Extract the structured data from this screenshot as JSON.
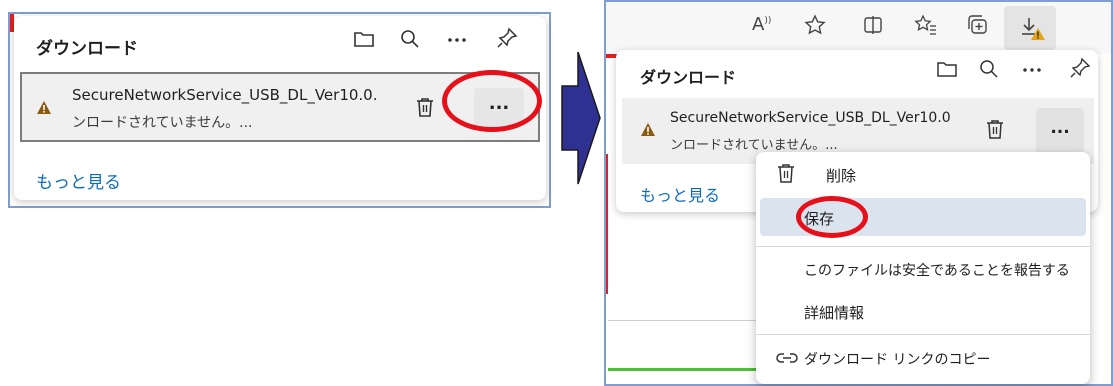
{
  "left": {
    "title": "ダウンロード",
    "file_name": "SecureNetworkService_USB_DL_Ver10.0.",
    "status_text": "ンロードされていません。...",
    "more_label": "...",
    "see_more": "もっと見る"
  },
  "right": {
    "toolbar": {
      "read_aloud_label": "A",
      "read_aloud_sup": "))"
    },
    "title": "ダウンロード",
    "file_name": "SecureNetworkService_USB_DL_Ver10.0",
    "status_text": "ンロードされていません。...",
    "more_label": "...",
    "see_more": "もっと見る",
    "menu": {
      "delete": "削除",
      "save": "保存",
      "report_safe": "このファイルは安全であることを報告する",
      "details": "詳細情報",
      "copy_link": "ダウンロード リンクのコピー"
    }
  },
  "colors": {
    "accent_link": "#0f6cbd",
    "highlight_ring": "#e5101a",
    "arrow_fill": "#2e3192",
    "warning": "#8a5a12"
  },
  "icons": [
    "folder-icon",
    "search-icon",
    "more-icon",
    "pin-icon",
    "warning-icon",
    "trash-icon",
    "read-aloud-icon",
    "favorite-star-icon",
    "split-screen-icon",
    "favorites-icon",
    "collections-icon",
    "download-icon",
    "link-icon"
  ]
}
